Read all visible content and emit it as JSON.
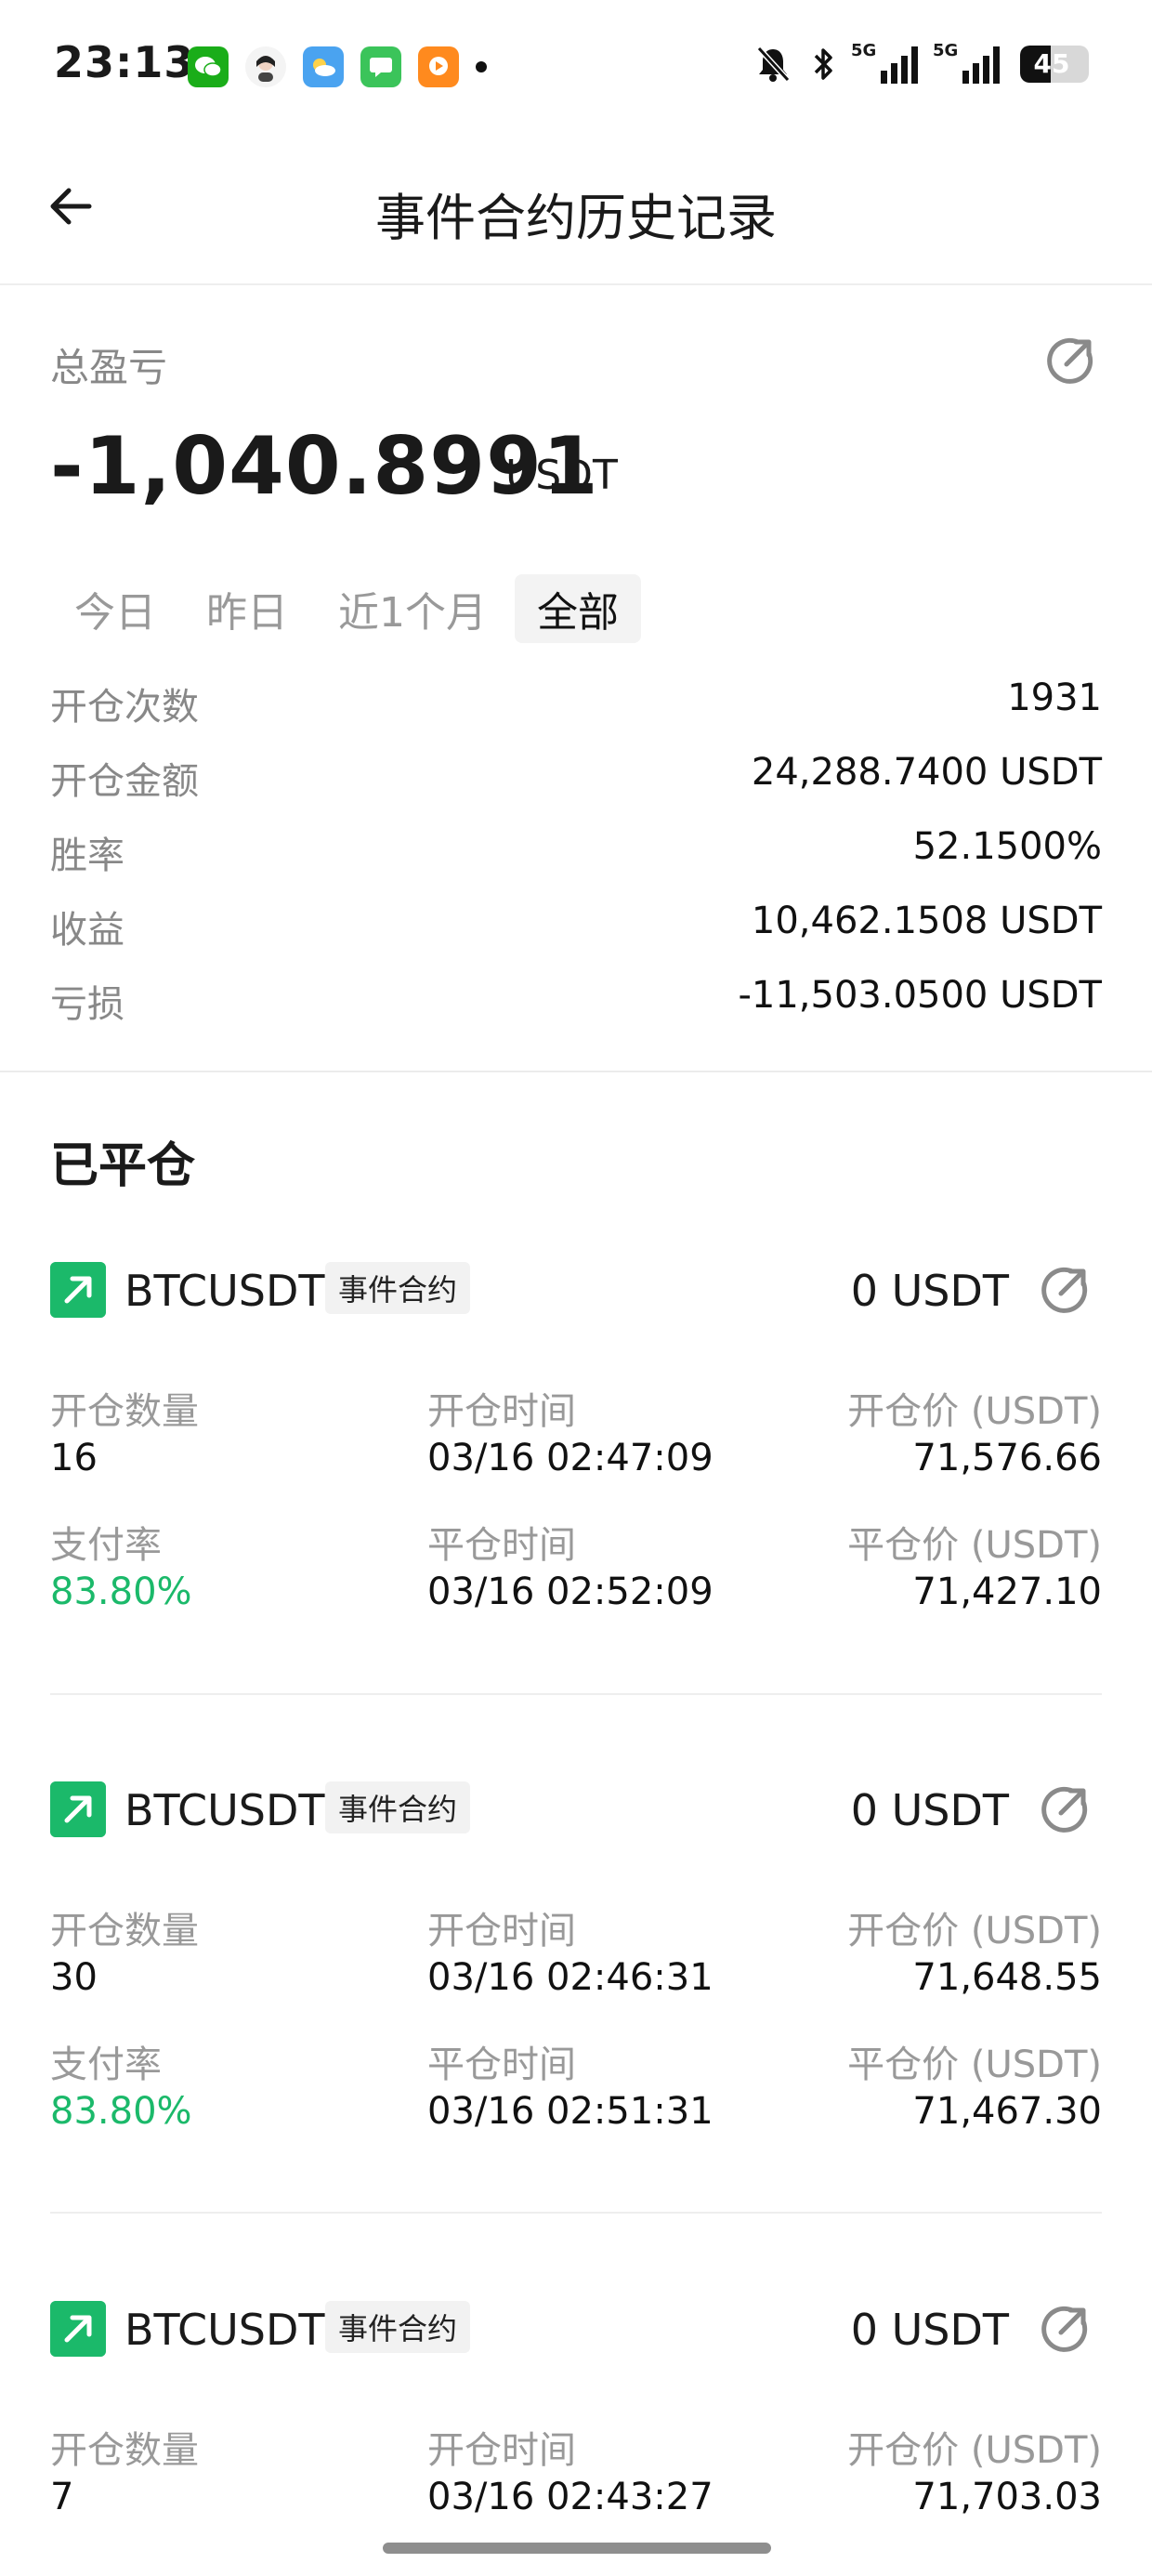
{
  "status_bar": {
    "time": "23:13",
    "battery": "45",
    "signal_labels": [
      "5G",
      "5G"
    ]
  },
  "header": {
    "title": "事件合约历史记录"
  },
  "summary": {
    "label": "总盈亏",
    "value": "-1,040.8991",
    "unit": "USDT",
    "tabs": [
      "今日",
      "昨日",
      "近1个月",
      "全部"
    ],
    "active_tab": "全部",
    "stats": [
      {
        "label": "开仓次数",
        "value": "1931"
      },
      {
        "label": "开仓金额",
        "value": "24,288.7400 USDT"
      },
      {
        "label": "胜率",
        "value": "52.1500%"
      },
      {
        "label": "收益",
        "value": "10,462.1508 USDT"
      },
      {
        "label": "亏损",
        "value": "-11,503.0500 USDT"
      }
    ]
  },
  "closed": {
    "title": "已平仓",
    "labels": {
      "qty": "开仓数量",
      "open_time": "开仓时间",
      "open_price": "开仓价 (USDT)",
      "payout": "支付率",
      "close_time": "平仓时间",
      "close_price": "平仓价 (USDT)"
    },
    "records": [
      {
        "symbol": "BTCUSDT",
        "tag": "事件合约",
        "pnl": "0 USDT",
        "qty": "16",
        "open_time": "03/16 02:47:09",
        "open_price": "71,576.66",
        "payout": "83.80%",
        "close_time": "03/16 02:52:09",
        "close_price": "71,427.10"
      },
      {
        "symbol": "BTCUSDT",
        "tag": "事件合约",
        "pnl": "0 USDT",
        "qty": "30",
        "open_time": "03/16 02:46:31",
        "open_price": "71,648.55",
        "payout": "83.80%",
        "close_time": "03/16 02:51:31",
        "close_price": "71,467.30"
      },
      {
        "symbol": "BTCUSDT",
        "tag": "事件合约",
        "pnl": "0 USDT",
        "qty": "7",
        "open_time": "03/16 02:43:27",
        "open_price": "71,703.03"
      }
    ]
  },
  "colors": {
    "green": "#1bb96a",
    "gray_text": "#888888"
  }
}
